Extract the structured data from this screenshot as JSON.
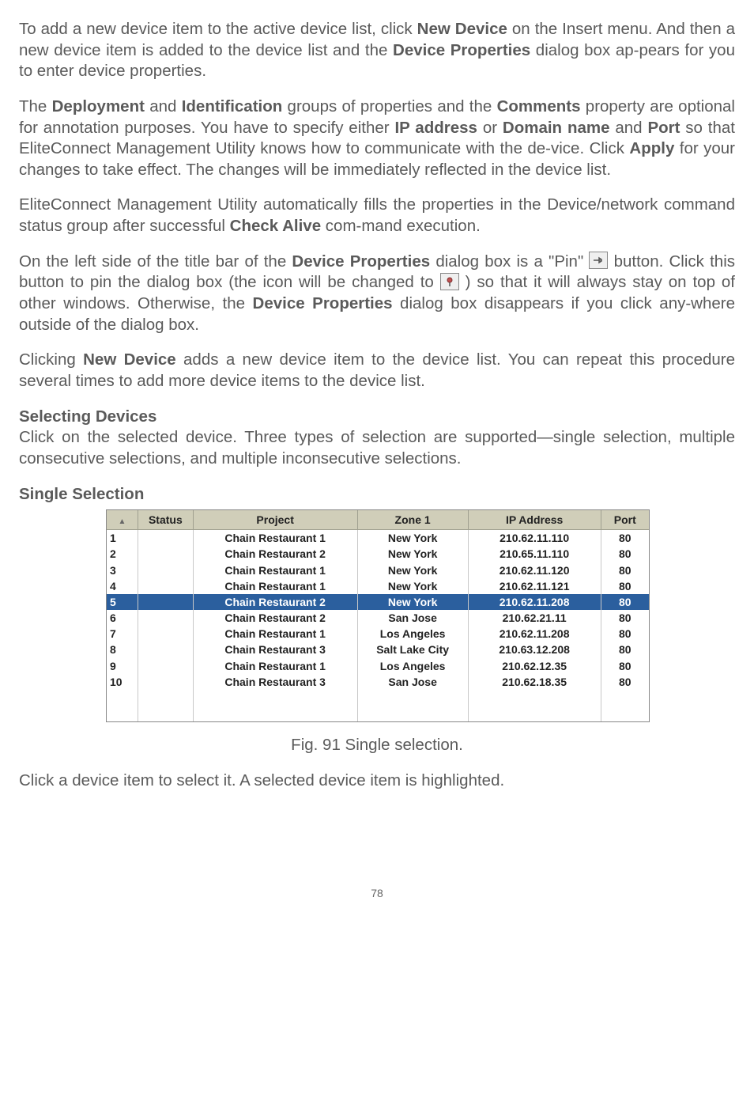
{
  "paragraphs": {
    "p1_a": "To add a new device item to the active device list, click ",
    "p1_b": "New Device",
    "p1_c": " on the Insert menu. And then a new device item is added to the device list and the ",
    "p1_d": "Device Properties",
    "p1_e": " dialog box ap-pears for you to enter device properties.",
    "p2_a": "The ",
    "p2_b": "Deployment",
    "p2_c": " and ",
    "p2_d": "Identification",
    "p2_e": " groups of properties and the ",
    "p2_f": "Comments",
    "p2_g": " property are optional for annotation purposes. You have to specify either ",
    "p2_h": "IP address",
    "p2_i": " or ",
    "p2_j": "Domain name",
    "p2_k": " and ",
    "p2_l": "Port",
    "p2_m": " so that EliteConnect Management Utility knows how to communicate with the de-vice. Click ",
    "p2_n": "Apply",
    "p2_o": " for your changes to take effect. The changes will be immediately reflected in the device list.",
    "p3_a": "EliteConnect Management Utility automatically fills the properties in the Device/network command status group after successful ",
    "p3_b": "Check Alive",
    "p3_c": " com-mand execution.",
    "p4_a": "On the left side of the title bar of the ",
    "p4_b": "Device Properties",
    "p4_c": " dialog box is a \"Pin\" ",
    "p4_d": " button. Click this button to pin the dialog box (the icon will be changed to ",
    "p4_e": " ) so that it will always stay on top of other windows. Otherwise, the ",
    "p4_f": "Device Properties",
    "p4_g": " dialog box disappears if you click any-where outside of the dialog box.",
    "p5_a": "Clicking ",
    "p5_b": "New Device",
    "p5_c": " adds a new device item to the device list. You can repeat this procedure several times to add more device items to the device list.",
    "h1": "Selecting Devices",
    "p6": "Click on the selected device. Three types of selection are supported—single selection, multiple consecutive selections, and multiple inconsecutive selections.",
    "h2": "Single Selection",
    "caption": "Fig. 91 Single selection.",
    "p7": "Click a device item to select it. A selected device item is highlighted.",
    "page": "78"
  },
  "table": {
    "headers": {
      "idx": "",
      "status": "Status",
      "project": "Project",
      "zone": "Zone 1",
      "ip": "IP Address",
      "port": "Port"
    },
    "rows": [
      {
        "idx": "1",
        "status": "",
        "project": "Chain Restaurant 1",
        "zone": "New York",
        "ip": "210.62.11.110",
        "port": "80",
        "sel": false
      },
      {
        "idx": "2",
        "status": "",
        "project": "Chain Restaurant 2",
        "zone": "New York",
        "ip": "210.65.11.110",
        "port": "80",
        "sel": false
      },
      {
        "idx": "3",
        "status": "",
        "project": "Chain Restaurant 1",
        "zone": "New York",
        "ip": "210.62.11.120",
        "port": "80",
        "sel": false
      },
      {
        "idx": "4",
        "status": "",
        "project": "Chain Restaurant 1",
        "zone": "New York",
        "ip": "210.62.11.121",
        "port": "80",
        "sel": false
      },
      {
        "idx": "5",
        "status": "",
        "project": "Chain Restaurant 2",
        "zone": "New York",
        "ip": "210.62.11.208",
        "port": "80",
        "sel": true
      },
      {
        "idx": "6",
        "status": "",
        "project": "Chain Restaurant 2",
        "zone": "San Jose",
        "ip": "210.62.21.11",
        "port": "80",
        "sel": false
      },
      {
        "idx": "7",
        "status": "",
        "project": "Chain Restaurant 1",
        "zone": "Los Angeles",
        "ip": "210.62.11.208",
        "port": "80",
        "sel": false
      },
      {
        "idx": "8",
        "status": "",
        "project": "Chain Restaurant 3",
        "zone": "Salt Lake City",
        "ip": "210.63.12.208",
        "port": "80",
        "sel": false
      },
      {
        "idx": "9",
        "status": "",
        "project": "Chain Restaurant 1",
        "zone": "Los Angeles",
        "ip": "210.62.12.35",
        "port": "80",
        "sel": false
      },
      {
        "idx": "10",
        "status": "",
        "project": "Chain Restaurant 3",
        "zone": "San Jose",
        "ip": "210.62.18.35",
        "port": "80",
        "sel": false
      }
    ]
  }
}
